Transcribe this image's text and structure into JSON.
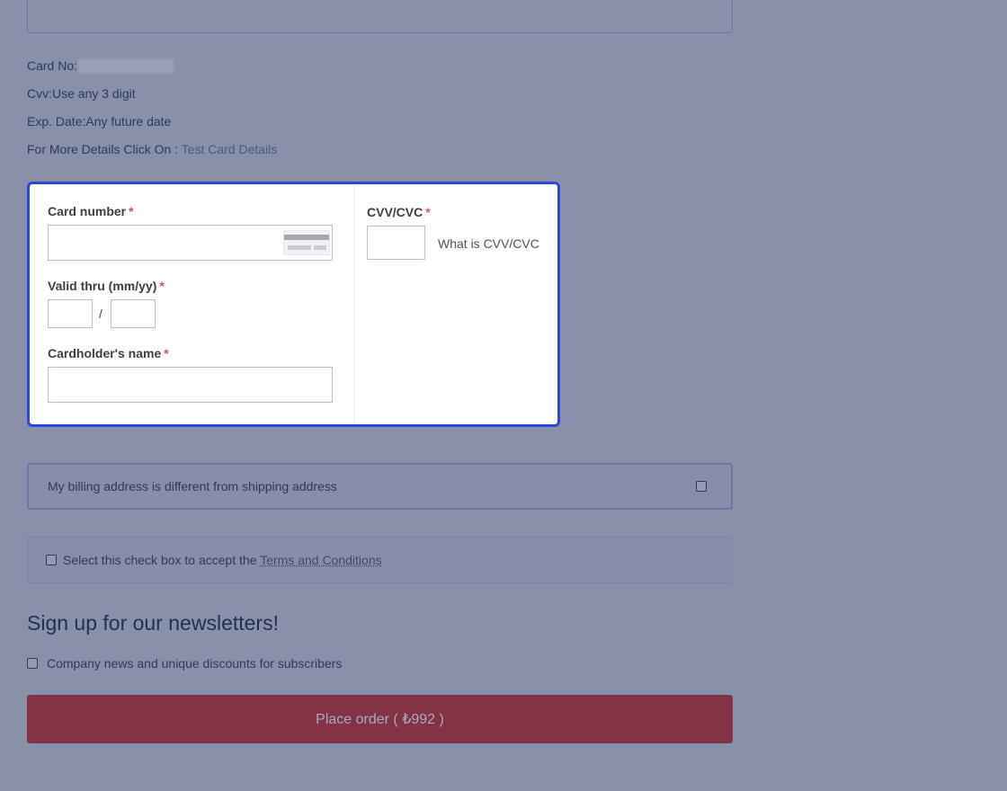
{
  "test_info": {
    "card_no_label": "Card No:",
    "cvv_line": "Cvv:Use any 3 digit",
    "exp_line": "Exp. Date:Any future date",
    "more_details_prefix": "For More Details Click On : ",
    "more_details_link": "Test Card Details"
  },
  "card_form": {
    "card_number_label": "Card number",
    "valid_thru_label": "Valid thru (mm/yy)",
    "date_separator": "/",
    "cardholder_label": "Cardholder's name",
    "cvv_label": "CVV/CVC",
    "cvv_help_link": "What is CVV/CVC",
    "required_mark": "*",
    "card_number_value": "",
    "month_value": "",
    "year_value": "",
    "cardholder_value": "",
    "cvv_value": ""
  },
  "billing": {
    "label": "My billing address is different from shipping address",
    "checked": false
  },
  "terms": {
    "prefix": "Select this check box to accept the ",
    "link": "Terms and Conditions",
    "checked": false
  },
  "newsletter": {
    "title": "Sign up for our newsletters!",
    "option": "Company news and unique discounts for subscribers",
    "checked": false
  },
  "place_order": {
    "label": "Place order ( ₺992 )"
  },
  "colors": {
    "overlay_bg": "#8990aa",
    "focus_border": "#2b4ad8",
    "required": "#e0533d",
    "order_button": "#843245"
  },
  "icons": {
    "card_placeholder": "credit-card-icon"
  }
}
